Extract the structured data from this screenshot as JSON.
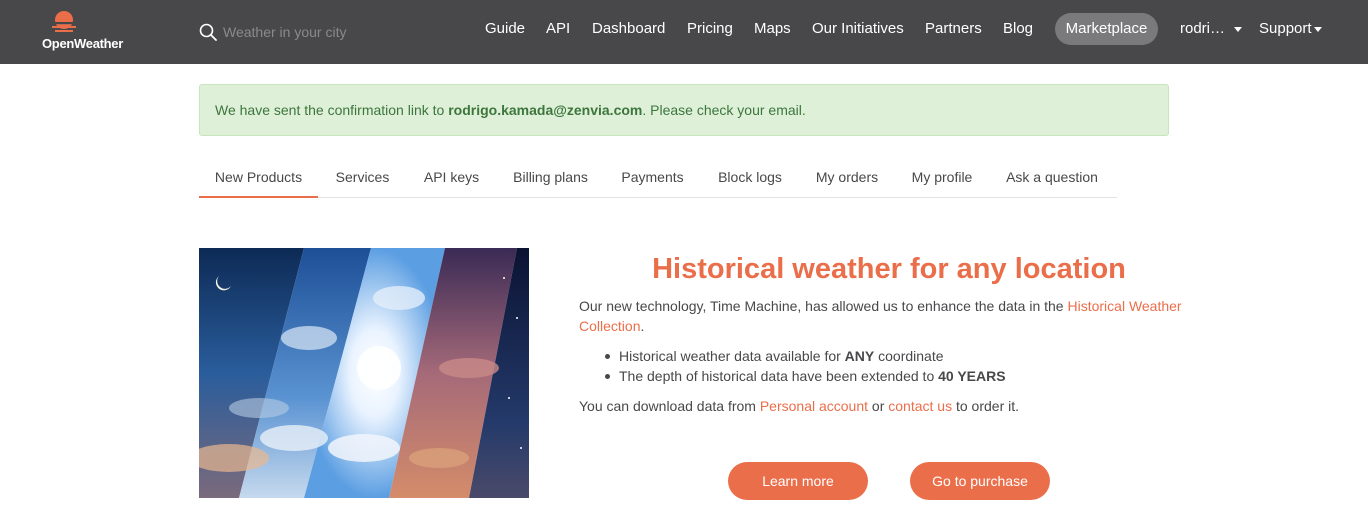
{
  "brand": {
    "name": "OpenWeather",
    "accent_color": "#eb6e4b",
    "navbar_color": "#48484a"
  },
  "search": {
    "placeholder": "Weather in your city",
    "value": ""
  },
  "nav": {
    "items": [
      "Guide",
      "API",
      "Dashboard",
      "Pricing",
      "Maps",
      "Our Initiatives",
      "Partners",
      "Blog"
    ],
    "marketplace": "Marketplace",
    "user": "rodri…",
    "support": "Support"
  },
  "alert": {
    "text_before": "We have sent the confirmation link to ",
    "email": "rodrigo.kamada@zenvia.com",
    "text_after": ". Please check your email.",
    "color": "#3c763d"
  },
  "tabs": {
    "items": [
      "New Products",
      "Services",
      "API keys",
      "Billing plans",
      "Payments",
      "Block logs",
      "My orders",
      "My profile",
      "Ask a question"
    ],
    "active": "New Products"
  },
  "product": {
    "title": "Historical weather for any location",
    "intro_before": "Our new technology, Time Machine, has allowed us to enhance the data in the ",
    "intro_link": "Historical Weather Collection",
    "intro_after": ".",
    "bullets": [
      {
        "text": "Historical weather data available for ",
        "bold": "ANY",
        "after": " coordinate"
      },
      {
        "text": "The depth of historical data have been extended to ",
        "bold": "40 YEARS",
        "after": ""
      }
    ],
    "download_before": "You can download data from ",
    "download_link1": "Personal account",
    "download_mid": " or ",
    "download_link2": "contact us",
    "download_after": " to order it.",
    "learn_more": "Learn more",
    "purchase": "Go to purchase"
  }
}
